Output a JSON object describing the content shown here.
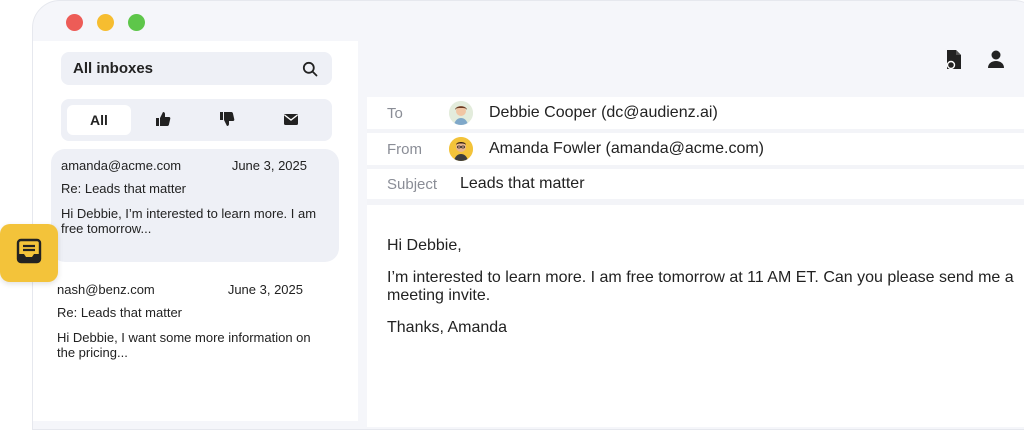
{
  "sidebar": {
    "search_title": "All inboxes",
    "filters": [
      {
        "label": "All",
        "icon": "",
        "active": true
      },
      {
        "label": "",
        "icon": "thumbs-up-icon",
        "active": false
      },
      {
        "label": "",
        "icon": "thumbs-down-icon",
        "active": false
      },
      {
        "label": "",
        "icon": "mail-icon",
        "active": false
      }
    ],
    "mails": [
      {
        "from": "amanda@acme.com",
        "date": "June 3, 2025",
        "subject": "Re: Leads that matter",
        "preview": "Hi Debbie, I’m interested to learn more.  I am free tomorrow..."
      },
      {
        "from": "nash@benz.com",
        "date": "June 3, 2025",
        "subject": "Re: Leads that matter",
        "preview": "Hi Debbie, I want some more information on the pricing..."
      }
    ]
  },
  "mail_view": {
    "to_label": "To",
    "to_value": "Debbie Cooper (dc@audienz.ai)",
    "from_label": "From",
    "from_value": "Amanda Fowler (amanda@acme.com)",
    "subject_label": "Subject",
    "subject_value": "Leads that matter",
    "body": {
      "greeting": "Hi Debbie,",
      "paragraph": "I’m interested to learn more.  I am free tomorrow at 11 AM ET.  Can you please send me a meeting invite.",
      "signoff": "Thanks, Amanda"
    }
  },
  "colors": {
    "accent": "#f3c33a",
    "window_bg": "#f5f6fa",
    "panel_bg": "#eef0f6"
  }
}
